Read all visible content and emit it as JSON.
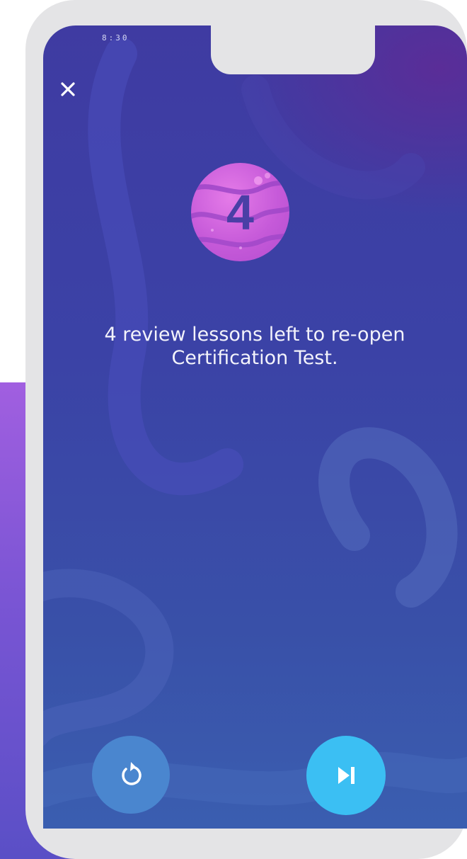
{
  "status_bar": {
    "time": "8:30"
  },
  "header": {
    "close_icon": "close-icon"
  },
  "badge": {
    "number": "4",
    "icon": "planet-badge-icon"
  },
  "message": {
    "line1": "4 review lessons left to re-open",
    "line2": "Certification Test."
  },
  "controls": {
    "restart_icon": "restart-icon",
    "skip_icon": "skip-next-icon"
  },
  "colors": {
    "screen_top": "#3f3ba2",
    "screen_bottom": "#3a5eb0",
    "badge": "#c65ad9",
    "badge_number": "#4a3fa6",
    "restart_button": "#4a86cf",
    "skip_button": "#3bbff3",
    "phone_frame": "#e4e4e6",
    "accent_purple": "#a15fe0"
  }
}
